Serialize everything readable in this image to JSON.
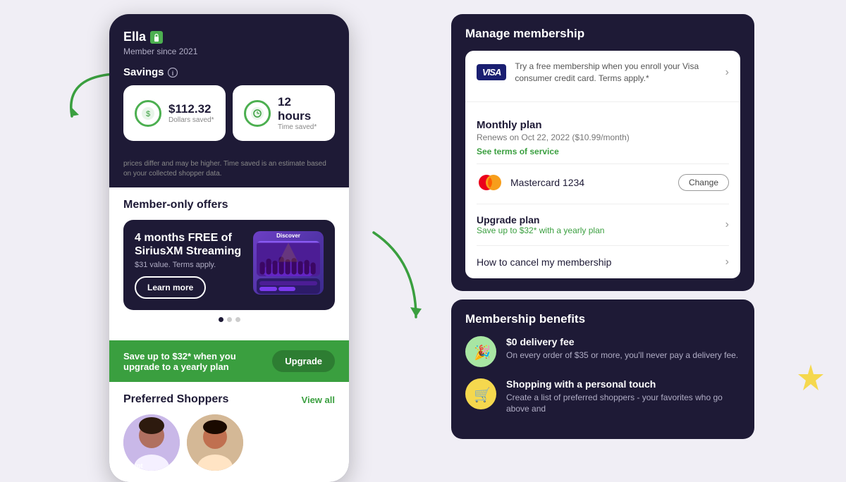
{
  "left_phone": {
    "user_name": "Ella",
    "member_since": "Member since 2021",
    "savings_label": "Savings",
    "dollars_saved_amount": "$112.32",
    "dollars_saved_sub": "Dollars saved*",
    "time_saved_amount": "12 hours",
    "time_saved_sub": "Time saved*",
    "fade_text": "prices differ and may be higher. Time saved is an estimate based on your collected shopper data.",
    "member_offers_title": "Member-only offers",
    "offer_title": "4 months FREE of SiriusXM Streaming",
    "offer_sub": "$31 value. Terms apply.",
    "offer_btn": "Learn more",
    "offer_image_label": "Discover",
    "dots": [
      "active",
      "inactive",
      "inactive"
    ],
    "upgrade_text": "Save up to $32* when you upgrade to a yearly plan",
    "upgrade_btn": "Upgrade",
    "preferred_title": "Preferred Shoppers",
    "view_all": "View all"
  },
  "manage_panel": {
    "title": "Manage membership",
    "visa_text": "Try a free membership when you enroll your Visa consumer credit card. Terms apply.*",
    "plan_title": "Monthly plan",
    "plan_renew": "Renews on Oct 22, 2022 ($10.99/month)",
    "plan_terms": "See terms of service",
    "card_name": "Mastercard 1234",
    "change_btn": "Change",
    "upgrade_title": "Upgrade plan",
    "upgrade_sub": "Save up to $32* with a yearly plan",
    "cancel_title": "How to cancel my membership"
  },
  "benefits_panel": {
    "title": "Membership benefits",
    "benefit1_title": "$0 delivery fee",
    "benefit1_desc": "On every order of $35 or more, you'll never pay a delivery fee.",
    "benefit2_title": "Shopping with a personal touch",
    "benefit2_desc": "Create a list of preferred shoppers - your favorites who go above and"
  }
}
